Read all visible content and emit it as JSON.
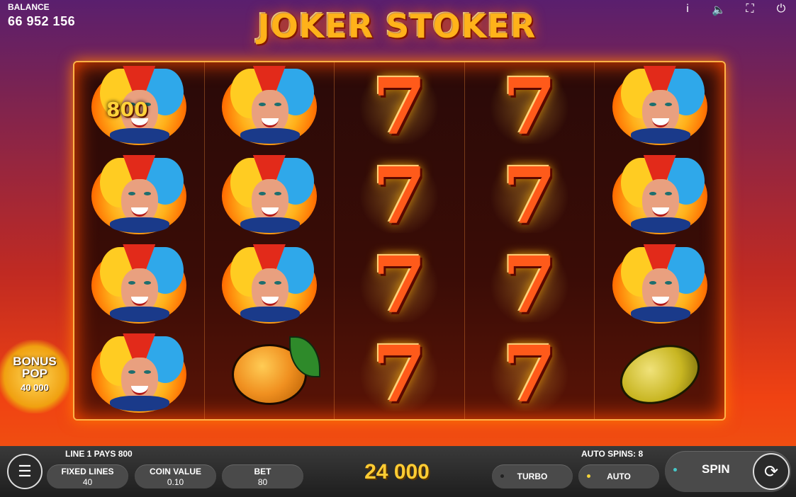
{
  "balance": {
    "label": "BALANCE",
    "value": "66 952 156"
  },
  "top_icons": [
    "info-icon",
    "sound-icon",
    "fullscreen-icon",
    "power-icon"
  ],
  "logo_text": "JOKER STOKER",
  "reels": [
    [
      "joker",
      "joker",
      "joker",
      "joker"
    ],
    [
      "joker",
      "joker",
      "joker",
      "orange"
    ],
    [
      "seven",
      "seven",
      "seven",
      "seven"
    ],
    [
      "seven",
      "seven",
      "seven",
      "seven"
    ],
    [
      "joker",
      "joker",
      "joker",
      "lemon"
    ]
  ],
  "win_badge": "800",
  "bonus_pop": {
    "title_line1": "BONUS",
    "title_line2": "POP",
    "amount": "40 000"
  },
  "status": {
    "line_pays": "LINE 1 PAYS 800",
    "auto_spins": "AUTO SPINS: 8"
  },
  "controls": {
    "fixed_lines": {
      "label": "FIXED LINES",
      "value": "40"
    },
    "coin_value": {
      "label": "COIN VALUE",
      "value": "0.10"
    },
    "bet": {
      "label": "BET",
      "value": "80"
    },
    "win_total": "24 000",
    "turbo_label": "TURBO",
    "auto_label": "AUTO",
    "spin_label": "SPIN"
  },
  "colors": {
    "accent_teal": "#46c8c8",
    "accent_yellow": "#f5d43a",
    "frame": "#ffb347"
  }
}
